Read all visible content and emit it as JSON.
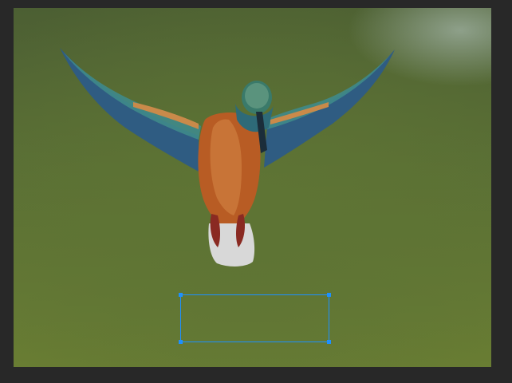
{
  "workspace": {
    "background": "#282828",
    "selection_color": "#1e90ff"
  },
  "photo": {
    "subject": "kingfisher-in-flight"
  },
  "selection": {
    "tool": "rectangle-selection"
  }
}
